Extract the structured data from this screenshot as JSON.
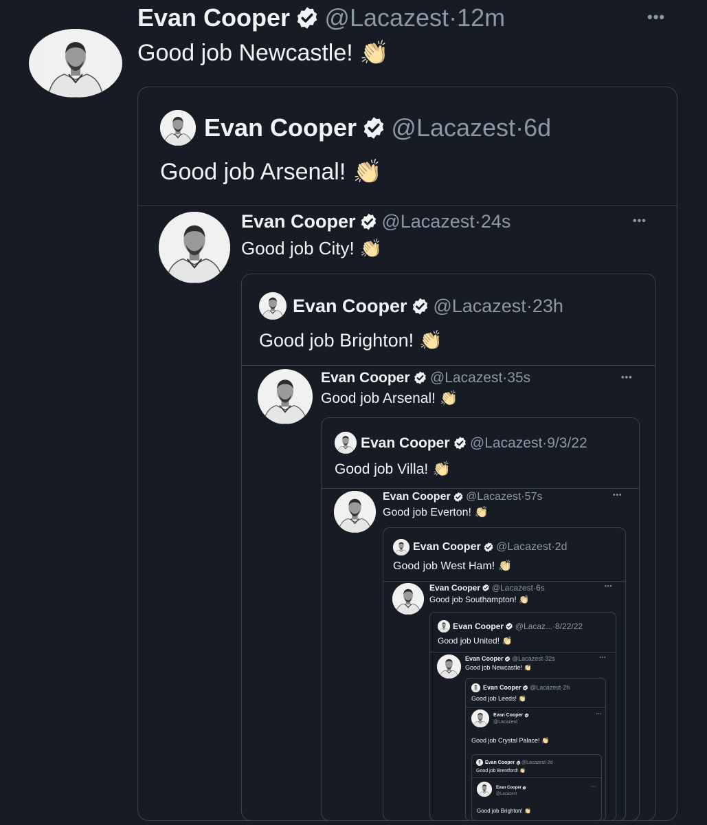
{
  "user": {
    "name": "Evan Cooper",
    "handle": "@Lacazest"
  },
  "more_label": "•••",
  "separator": " · ",
  "clap_emoji": "👏",
  "tweets": [
    {
      "text": "Good job Newcastle!",
      "time": "12m"
    },
    {
      "text": "Good job Arsenal!",
      "time": "6d"
    },
    {
      "text": "Good job City!",
      "time": "24s"
    },
    {
      "text": "Good job Brighton!",
      "time": "23h"
    },
    {
      "text": "Good job Arsenal!",
      "time": "35s"
    },
    {
      "text": "Good job Villa!",
      "time": "9/3/22"
    },
    {
      "text": "Good job Everton!",
      "time": "57s"
    },
    {
      "text": "Good job West Ham!",
      "time": "2d"
    },
    {
      "text": "Good job Southampton!",
      "time": "6s"
    },
    {
      "text": "Good job United!",
      "time": "8/22/22",
      "handle_short": "@Lacaz..."
    },
    {
      "text": "Good job Newcastle!",
      "time": "32s"
    },
    {
      "text": "Good job Leeds!",
      "time": "2h"
    },
    {
      "text": "Good job Crystal Palace!"
    },
    {
      "text": "Good job Brentford!",
      "time": "2d"
    },
    {
      "text": "Good job Brighton!"
    }
  ],
  "colors": {
    "background": "#161b24",
    "border": "#3a4350",
    "muted": "#8b98a5",
    "verified": "#f2f3f4"
  }
}
